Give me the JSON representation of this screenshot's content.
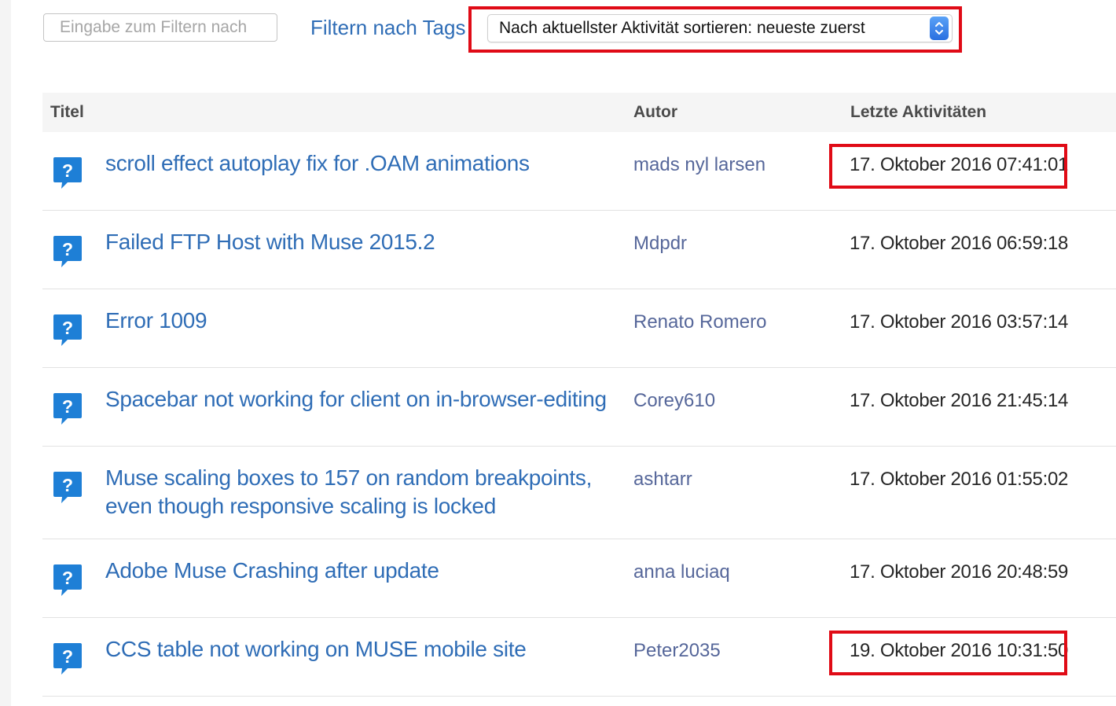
{
  "toolbar": {
    "filter_placeholder": "Eingabe zum Filtern nach",
    "tags_link": "Filtern nach Tags",
    "sort_label": "Nach aktuellster Aktivität sortieren: neueste zuerst"
  },
  "table": {
    "columns": [
      "Titel",
      "Autor",
      "Letzte Aktivitäten"
    ],
    "rows": [
      {
        "title": "scroll effect autoplay fix for .OAM animations",
        "author": "mads nyl larsen",
        "activity": "17. Oktober 2016 07:41:01"
      },
      {
        "title": "Failed FTP Host with Muse 2015.2",
        "author": "Mdpdr",
        "activity": "17. Oktober 2016 06:59:18"
      },
      {
        "title": "Error 1009",
        "author": "Renato Romero",
        "activity": "17. Oktober 2016 03:57:14"
      },
      {
        "title": "Spacebar not working for client on in-browser-editing",
        "author": "Corey610",
        "activity": "17. Oktober 2016 21:45:14"
      },
      {
        "title": "Muse scaling boxes to 157 on random breakpoints, even though responsive scaling is locked",
        "author": "ashtarr",
        "activity": "17. Oktober 2016 01:55:02"
      },
      {
        "title": "Adobe Muse Crashing after update",
        "author": "anna luciaq",
        "activity": "17. Oktober 2016 20:48:59"
      },
      {
        "title": "CCS table not working on MUSE mobile site",
        "author": "Peter2035",
        "activity": "19. Oktober 2016 10:31:50"
      }
    ]
  },
  "icons": {
    "question": "question-bubble-icon",
    "sort_stepper": "up-down-chevron-icon"
  },
  "colors": {
    "link_blue": "#2f6db6",
    "author_blue": "#56679a",
    "icon_blue": "#1e7fd6",
    "highlight_red": "#e00b16",
    "header_bg": "#f5f5f5"
  }
}
